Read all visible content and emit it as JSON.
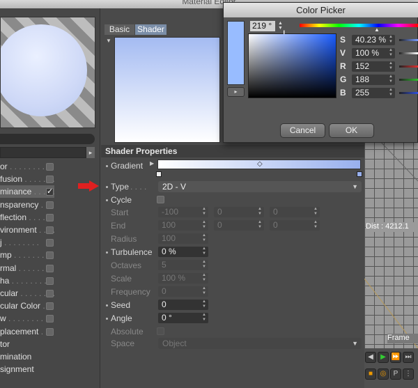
{
  "material_editor": {
    "title": "Material Editor",
    "channels": [
      {
        "label": "or",
        "checked": false
      },
      {
        "label": "fusion",
        "checked": false
      },
      {
        "label": "minance",
        "checked": true,
        "selected": true
      },
      {
        "label": "nsparency",
        "checked": false
      },
      {
        "label": "flection",
        "checked": false
      },
      {
        "label": "vironment",
        "checked": false
      },
      {
        "label": "j",
        "checked": false
      },
      {
        "label": "mp",
        "checked": false
      },
      {
        "label": "rmal",
        "checked": false
      },
      {
        "label": "ha",
        "checked": false
      },
      {
        "label": "cular",
        "checked": false
      },
      {
        "label": "cular Color",
        "checked": false
      },
      {
        "label": "w",
        "checked": false
      },
      {
        "label": "placement",
        "checked": false
      },
      {
        "label": "tor"
      },
      {
        "label": "mination"
      },
      {
        "label": "signment"
      }
    ],
    "tabs": [
      "Basic",
      "Shader"
    ],
    "shader_properties": {
      "header": "Shader Properties",
      "gradient_label": "Gradient",
      "gradient_colors": [
        "#ffffff",
        "#98b0ee"
      ],
      "type_label": "Type",
      "type_value": "2D - V",
      "cycle_label": "Cycle",
      "start_label": "Start",
      "start_values": [
        "-100",
        "0",
        "0"
      ],
      "end_label": "End",
      "end_values": [
        "100",
        "0",
        "0"
      ],
      "radius_label": "Radius",
      "radius_value": "100",
      "turbulence_label": "Turbulence",
      "turbulence_value": "0 %",
      "octaves_label": "Octaves",
      "octaves_value": "5",
      "scale_label": "Scale",
      "scale_value": "100 %",
      "frequency_label": "Frequency",
      "frequency_value": "0",
      "seed_label": "Seed",
      "seed_value": "0",
      "angle_label": "Angle",
      "angle_value": "0 °",
      "absolute_label": "Absolute",
      "space_label": "Space",
      "space_value": "Object"
    }
  },
  "viewport": {
    "dist_text": "Dist : 4212.1",
    "frame_text": "Frame"
  },
  "color_picker": {
    "title": "Color Picker",
    "hue_value": "219 °",
    "swatch_color": "#98bcff",
    "fields": [
      {
        "label": "S",
        "value": "40.23 %",
        "color": "#7a9cff"
      },
      {
        "label": "V",
        "value": "100 %",
        "color": "#ffffff"
      },
      {
        "label": "R",
        "value": "152",
        "color": "#e03030"
      },
      {
        "label": "G",
        "value": "188",
        "color": "#30c030"
      },
      {
        "label": "B",
        "value": "255",
        "color": "#3050e0"
      }
    ],
    "cancel_label": "Cancel",
    "ok_label": "OK"
  }
}
